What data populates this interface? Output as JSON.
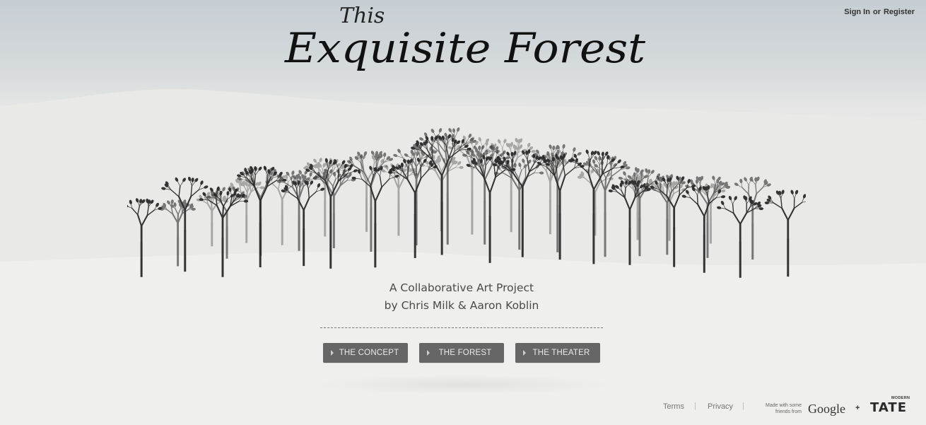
{
  "header": {
    "title_small": "This",
    "title_main": "Exquisite Forest",
    "auth": {
      "sign_in": "Sign In",
      "or": "or",
      "register": "Register"
    }
  },
  "hero": {
    "tagline_line1": "A Collaborative Art Project",
    "tagline_line2": "by Chris Milk & Aaron Koblin"
  },
  "nav": {
    "buttons": [
      {
        "label": "THE CONCEPT",
        "icon": "caret-right-icon"
      },
      {
        "label": "THE FOREST",
        "icon": "caret-right-icon"
      },
      {
        "label": "THE THEATER",
        "icon": "caret-right-icon"
      }
    ]
  },
  "footer": {
    "terms": "Terms",
    "privacy": "Privacy",
    "separator": "|",
    "made_with_line1": "Made with some",
    "made_with_line2": "friends from",
    "google": "Google",
    "plus": "+",
    "tate_modern": "MODERN",
    "tate": "TATE"
  },
  "colors": {
    "button_bg": "#666666",
    "button_text": "#e9e9e9",
    "sky": "#c9cfd3",
    "snow": "#ececeb",
    "tree_ink": "#2b2b2b"
  }
}
